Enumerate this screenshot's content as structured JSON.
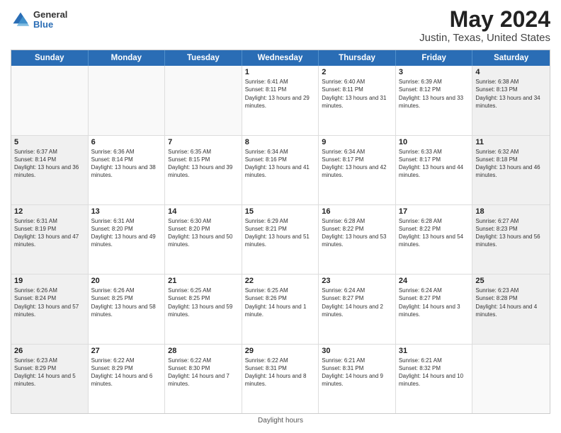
{
  "header": {
    "logo_line1": "General",
    "logo_line2": "Blue",
    "title": "May 2024",
    "subtitle": "Justin, Texas, United States"
  },
  "calendar": {
    "days_of_week": [
      "Sunday",
      "Monday",
      "Tuesday",
      "Wednesday",
      "Thursday",
      "Friday",
      "Saturday"
    ],
    "weeks": [
      [
        {
          "day": "",
          "info": "",
          "empty": true
        },
        {
          "day": "",
          "info": "",
          "empty": true
        },
        {
          "day": "",
          "info": "",
          "empty": true
        },
        {
          "day": "1",
          "info": "Sunrise: 6:41 AM\nSunset: 8:11 PM\nDaylight: 13 hours and 29 minutes.",
          "empty": false
        },
        {
          "day": "2",
          "info": "Sunrise: 6:40 AM\nSunset: 8:11 PM\nDaylight: 13 hours and 31 minutes.",
          "empty": false
        },
        {
          "day": "3",
          "info": "Sunrise: 6:39 AM\nSunset: 8:12 PM\nDaylight: 13 hours and 33 minutes.",
          "empty": false
        },
        {
          "day": "4",
          "info": "Sunrise: 6:38 AM\nSunset: 8:13 PM\nDaylight: 13 hours and 34 minutes.",
          "empty": false,
          "shaded": true
        }
      ],
      [
        {
          "day": "5",
          "info": "Sunrise: 6:37 AM\nSunset: 8:14 PM\nDaylight: 13 hours and 36 minutes.",
          "empty": false,
          "shaded": true
        },
        {
          "day": "6",
          "info": "Sunrise: 6:36 AM\nSunset: 8:14 PM\nDaylight: 13 hours and 38 minutes.",
          "empty": false
        },
        {
          "day": "7",
          "info": "Sunrise: 6:35 AM\nSunset: 8:15 PM\nDaylight: 13 hours and 39 minutes.",
          "empty": false
        },
        {
          "day": "8",
          "info": "Sunrise: 6:34 AM\nSunset: 8:16 PM\nDaylight: 13 hours and 41 minutes.",
          "empty": false
        },
        {
          "day": "9",
          "info": "Sunrise: 6:34 AM\nSunset: 8:17 PM\nDaylight: 13 hours and 42 minutes.",
          "empty": false
        },
        {
          "day": "10",
          "info": "Sunrise: 6:33 AM\nSunset: 8:17 PM\nDaylight: 13 hours and 44 minutes.",
          "empty": false
        },
        {
          "day": "11",
          "info": "Sunrise: 6:32 AM\nSunset: 8:18 PM\nDaylight: 13 hours and 46 minutes.",
          "empty": false,
          "shaded": true
        }
      ],
      [
        {
          "day": "12",
          "info": "Sunrise: 6:31 AM\nSunset: 8:19 PM\nDaylight: 13 hours and 47 minutes.",
          "empty": false,
          "shaded": true
        },
        {
          "day": "13",
          "info": "Sunrise: 6:31 AM\nSunset: 8:20 PM\nDaylight: 13 hours and 49 minutes.",
          "empty": false
        },
        {
          "day": "14",
          "info": "Sunrise: 6:30 AM\nSunset: 8:20 PM\nDaylight: 13 hours and 50 minutes.",
          "empty": false
        },
        {
          "day": "15",
          "info": "Sunrise: 6:29 AM\nSunset: 8:21 PM\nDaylight: 13 hours and 51 minutes.",
          "empty": false
        },
        {
          "day": "16",
          "info": "Sunrise: 6:28 AM\nSunset: 8:22 PM\nDaylight: 13 hours and 53 minutes.",
          "empty": false
        },
        {
          "day": "17",
          "info": "Sunrise: 6:28 AM\nSunset: 8:22 PM\nDaylight: 13 hours and 54 minutes.",
          "empty": false
        },
        {
          "day": "18",
          "info": "Sunrise: 6:27 AM\nSunset: 8:23 PM\nDaylight: 13 hours and 56 minutes.",
          "empty": false,
          "shaded": true
        }
      ],
      [
        {
          "day": "19",
          "info": "Sunrise: 6:26 AM\nSunset: 8:24 PM\nDaylight: 13 hours and 57 minutes.",
          "empty": false,
          "shaded": true
        },
        {
          "day": "20",
          "info": "Sunrise: 6:26 AM\nSunset: 8:25 PM\nDaylight: 13 hours and 58 minutes.",
          "empty": false
        },
        {
          "day": "21",
          "info": "Sunrise: 6:25 AM\nSunset: 8:25 PM\nDaylight: 13 hours and 59 minutes.",
          "empty": false
        },
        {
          "day": "22",
          "info": "Sunrise: 6:25 AM\nSunset: 8:26 PM\nDaylight: 14 hours and 1 minute.",
          "empty": false
        },
        {
          "day": "23",
          "info": "Sunrise: 6:24 AM\nSunset: 8:27 PM\nDaylight: 14 hours and 2 minutes.",
          "empty": false
        },
        {
          "day": "24",
          "info": "Sunrise: 6:24 AM\nSunset: 8:27 PM\nDaylight: 14 hours and 3 minutes.",
          "empty": false
        },
        {
          "day": "25",
          "info": "Sunrise: 6:23 AM\nSunset: 8:28 PM\nDaylight: 14 hours and 4 minutes.",
          "empty": false,
          "shaded": true
        }
      ],
      [
        {
          "day": "26",
          "info": "Sunrise: 6:23 AM\nSunset: 8:29 PM\nDaylight: 14 hours and 5 minutes.",
          "empty": false,
          "shaded": true
        },
        {
          "day": "27",
          "info": "Sunrise: 6:22 AM\nSunset: 8:29 PM\nDaylight: 14 hours and 6 minutes.",
          "empty": false
        },
        {
          "day": "28",
          "info": "Sunrise: 6:22 AM\nSunset: 8:30 PM\nDaylight: 14 hours and 7 minutes.",
          "empty": false
        },
        {
          "day": "29",
          "info": "Sunrise: 6:22 AM\nSunset: 8:31 PM\nDaylight: 14 hours and 8 minutes.",
          "empty": false
        },
        {
          "day": "30",
          "info": "Sunrise: 6:21 AM\nSunset: 8:31 PM\nDaylight: 14 hours and 9 minutes.",
          "empty": false
        },
        {
          "day": "31",
          "info": "Sunrise: 6:21 AM\nSunset: 8:32 PM\nDaylight: 14 hours and 10 minutes.",
          "empty": false
        },
        {
          "day": "",
          "info": "",
          "empty": true,
          "shaded": true
        }
      ]
    ]
  },
  "footer": {
    "note": "Daylight hours"
  },
  "colors": {
    "header_bg": "#2a6db5",
    "header_text": "#ffffff",
    "shaded_bg": "#f0f0f0",
    "empty_bg": "#f9f9f9",
    "border": "#cccccc"
  }
}
